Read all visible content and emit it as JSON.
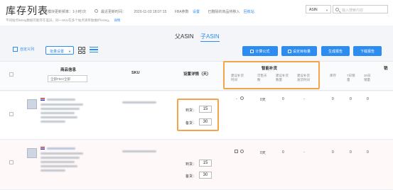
{
  "header": {
    "title": "库存列表",
    "meta": {
      "update_freq": "本模块更新频率：1小时/次",
      "last_update_label": "最近更新时间：",
      "last_update_time": "2020-11-03 18:07:15",
      "fba_label": "FBA参数",
      "fba_link": "设置",
      "resolved_text": "已删除的商品将移入",
      "resolved_link": "回收站"
    },
    "subline": "不同站点listing数据可能存在差异，同一SKU在多个站点请单独维护listing。",
    "subline_link": "详情",
    "asin_select": "ASIN",
    "search_placeholder": "输入搜索内容"
  },
  "toggle": {
    "parent": "父ASIN",
    "child": "子ASIN"
  },
  "toolbar": {
    "custom_cols": "自定义列",
    "qty_setting": "批量设置",
    "buttons": {
      "formula": "计算公式",
      "target": "设定目标量",
      "report": "生成报告",
      "download": "下载报告"
    }
  },
  "table": {
    "headers": {
      "product": "商品信息",
      "sku": "SKU",
      "restock": "设置详情（天）",
      "smart": "智能补货",
      "suggest_days": "建议补货时间",
      "sell_days": "可售天数",
      "suggest_qty": "建议补货数量",
      "suggest_ship": "建议补货发货时间",
      "col_a": "库存",
      "col_b": "7日销量",
      "col_c": "30日销量",
      "col_d": "销"
    },
    "filter_select": "全部FBA/全部",
    "rows": [
      {
        "clock": "⏱",
        "days": "0天",
        "qty": "0",
        "dash": "-",
        "a": "0",
        "b": "0",
        "c": "0",
        "arrival_label": "到货：",
        "arrival": "15",
        "ready_label": "备货：",
        "ready": "30"
      },
      {
        "clock": "⏱",
        "days": "0天",
        "qty": "0",
        "dash": "-",
        "a": "0",
        "b": "0",
        "c": "0",
        "arrival_label": "到货：",
        "arrival": "15",
        "ready_label": "备货：",
        "ready": "30"
      }
    ]
  },
  "colors": {
    "accent": "#2d8cf0",
    "highlight": "#f5a44a"
  }
}
